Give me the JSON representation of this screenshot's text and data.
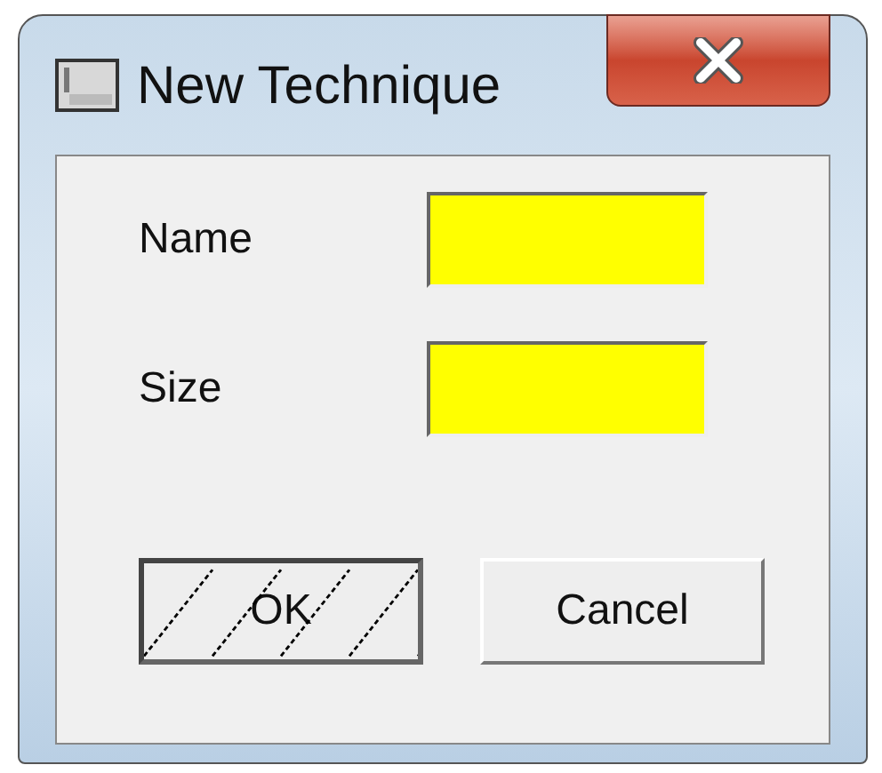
{
  "window": {
    "title": "New Technique"
  },
  "fields": [
    {
      "label": "Name",
      "highlighted": true
    },
    {
      "label": "Size",
      "highlighted": true
    }
  ],
  "buttons": [
    {
      "label": "OK",
      "pressed": true
    },
    {
      "label": "Cancel",
      "pressed": false
    }
  ]
}
